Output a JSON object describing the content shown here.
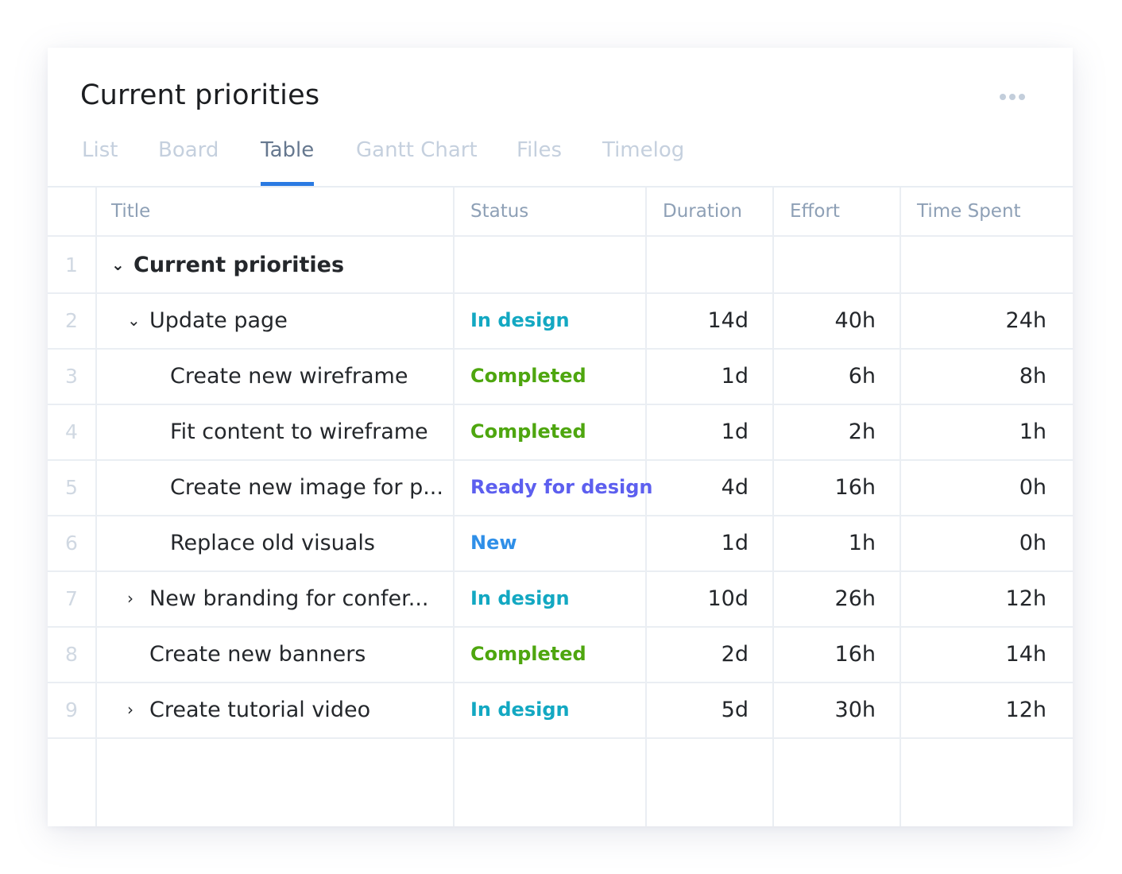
{
  "header": {
    "title": "Current priorities",
    "more_icon": "more-horizontal-icon"
  },
  "tabs": [
    {
      "label": "List",
      "active": false
    },
    {
      "label": "Board",
      "active": false
    },
    {
      "label": "Table",
      "active": true
    },
    {
      "label": "Gantt Chart",
      "active": false
    },
    {
      "label": "Files",
      "active": false
    },
    {
      "label": "Timelog",
      "active": false
    }
  ],
  "table": {
    "columns": [
      "Title",
      "Status",
      "Duration",
      "Effort",
      "Time Spent"
    ],
    "status_colors": {
      "In design": "#13a8c2",
      "Completed": "#4ea60f",
      "Ready for design": "#5d5fef",
      "New": "#2f8fe8"
    },
    "rows": [
      {
        "num": "1",
        "title": "Current priorities",
        "level": 0,
        "toggle": "expanded",
        "bold": true,
        "status": "",
        "duration": "",
        "effort": "",
        "time_spent": ""
      },
      {
        "num": "2",
        "title": "Update page",
        "level": 1,
        "toggle": "expanded",
        "bold": false,
        "status": "In design",
        "duration": "14d",
        "effort": "40h",
        "time_spent": "24h"
      },
      {
        "num": "3",
        "title": "Create new wireframe",
        "level": 2,
        "toggle": "none",
        "bold": false,
        "status": "Completed",
        "duration": "1d",
        "effort": "6h",
        "time_spent": "8h"
      },
      {
        "num": "4",
        "title": "Fit content to wireframe",
        "level": 2,
        "toggle": "none",
        "bold": false,
        "status": "Completed",
        "duration": "1d",
        "effort": "2h",
        "time_spent": "1h"
      },
      {
        "num": "5",
        "title": "Create new image for p...",
        "level": 2,
        "toggle": "none",
        "bold": false,
        "status": "Ready for design",
        "duration": "4d",
        "effort": "16h",
        "time_spent": "0h"
      },
      {
        "num": "6",
        "title": "Replace old visuals",
        "level": 2,
        "toggle": "none",
        "bold": false,
        "status": "New",
        "duration": "1d",
        "effort": "1h",
        "time_spent": "0h"
      },
      {
        "num": "7",
        "title": "New branding for confer...",
        "level": 1,
        "toggle": "collapsed",
        "bold": false,
        "status": "In design",
        "duration": "10d",
        "effort": "26h",
        "time_spent": "12h"
      },
      {
        "num": "8",
        "title": "Create new banners",
        "level": 1,
        "toggle": "none",
        "bold": false,
        "status": "Completed",
        "duration": "2d",
        "effort": "16h",
        "time_spent": "14h"
      },
      {
        "num": "9",
        "title": "Create tutorial video",
        "level": 1,
        "toggle": "collapsed",
        "bold": false,
        "status": "In design",
        "duration": "5d",
        "effort": "30h",
        "time_spent": "12h"
      }
    ]
  }
}
